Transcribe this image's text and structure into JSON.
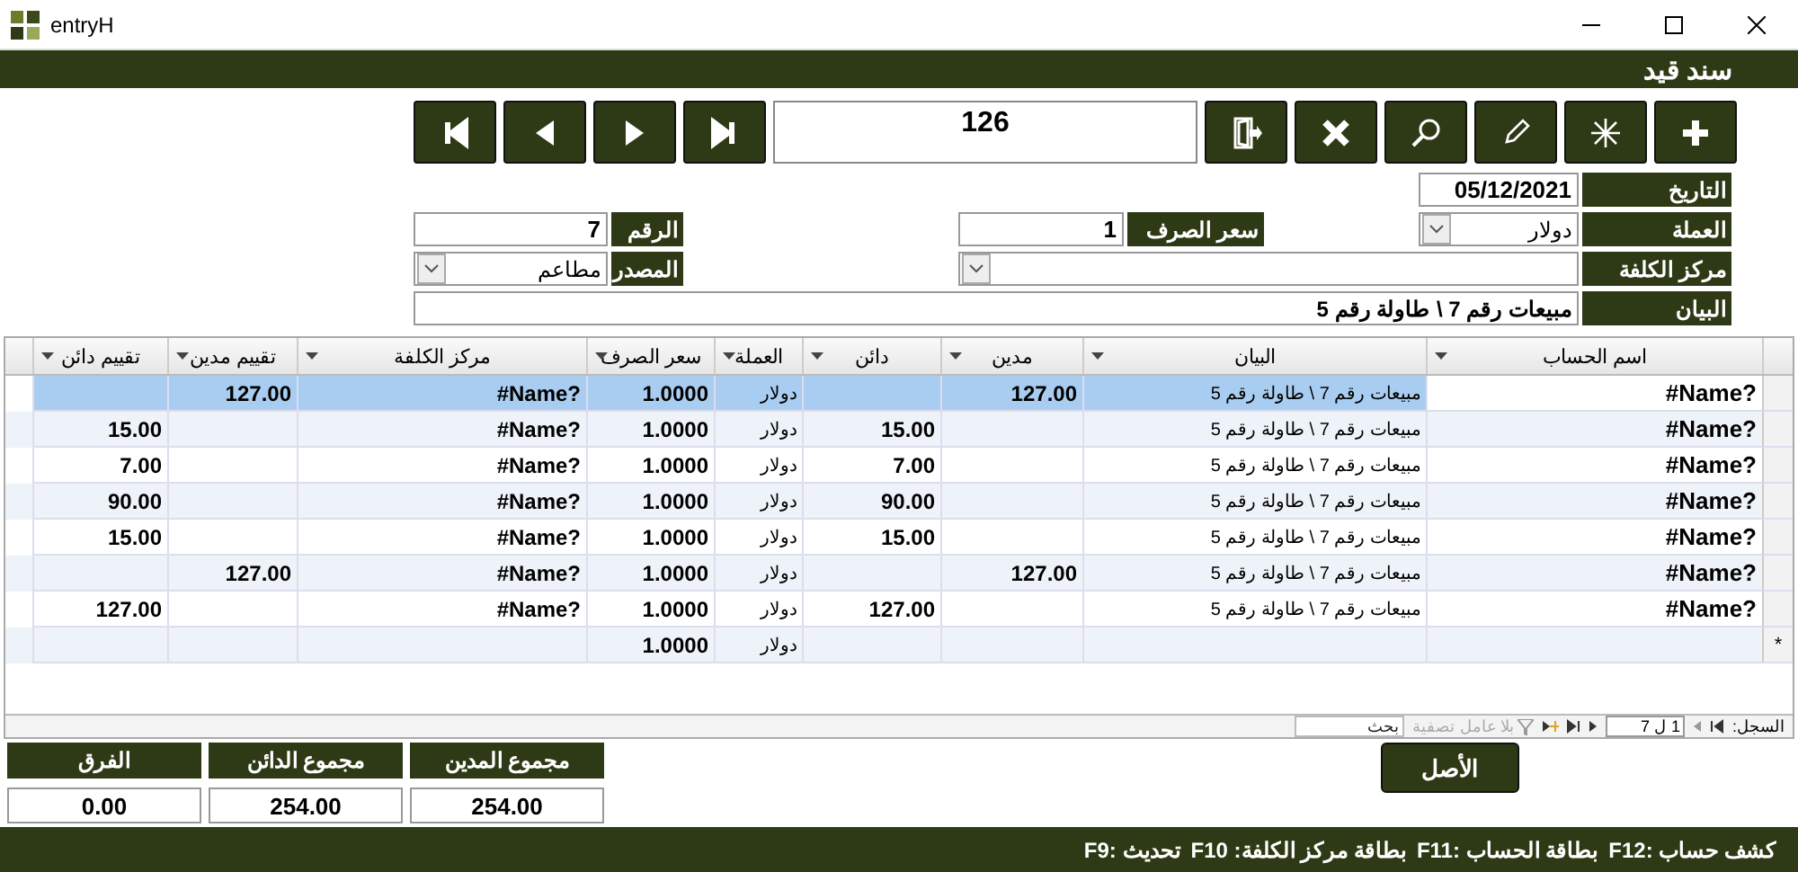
{
  "window": {
    "title": "entryH"
  },
  "header": {
    "title": "سند قيد"
  },
  "toolbar": {
    "record_number": "126"
  },
  "form": {
    "date_label": "التاريخ",
    "date": "05/12/2021",
    "currency_label": "العملة",
    "currency": "دولار",
    "rate_label": "سعر الصرف",
    "rate": "1",
    "number_label": "الرقم",
    "number": "7",
    "cost_center_label": "مركز الكلفة",
    "source_label": "المصدر",
    "source": "مطاعم",
    "description_label": "البيان",
    "description": "مبيعات رقم 7 \\ طاولة رقم 5"
  },
  "grid": {
    "columns": [
      {
        "label": "اسم الحساب"
      },
      {
        "label": "البيان"
      },
      {
        "label": "مدين"
      },
      {
        "label": "دائن"
      },
      {
        "label": "العملة"
      },
      {
        "label": "سعر الصرف"
      },
      {
        "label": "مركز الكلفة"
      },
      {
        "label": "تقييم مدين"
      },
      {
        "label": "تقييم دائن"
      }
    ],
    "rows": [
      {
        "selected": true,
        "account": "#Name?",
        "description": "مبيعات رقم 7 \\ طاولة رقم 5",
        "debit": "127.00",
        "currency": "دولار",
        "rate": "1.0000",
        "cost_center": "#Name?",
        "eval_debit": "127.00"
      },
      {
        "selected": false,
        "account": "#Name?",
        "description": "مبيعات رقم 7 \\ طاولة رقم 5",
        "credit": "15.00",
        "currency": "دولار",
        "rate": "1.0000",
        "cost_center": "#Name?",
        "eval_credit": "15.00"
      },
      {
        "selected": false,
        "account": "#Name?",
        "description": "مبيعات رقم 7 \\ طاولة رقم 5",
        "credit": "7.00",
        "currency": "دولار",
        "rate": "1.0000",
        "cost_center": "#Name?",
        "eval_credit": "7.00"
      },
      {
        "selected": false,
        "account": "#Name?",
        "description": "مبيعات رقم 7 \\ طاولة رقم 5",
        "credit": "90.00",
        "currency": "دولار",
        "rate": "1.0000",
        "cost_center": "#Name?",
        "eval_credit": "90.00"
      },
      {
        "selected": false,
        "account": "#Name?",
        "description": "مبيعات رقم 7 \\ طاولة رقم 5",
        "credit": "15.00",
        "currency": "دولار",
        "rate": "1.0000",
        "cost_center": "#Name?",
        "eval_credit": "15.00"
      },
      {
        "selected": false,
        "account": "#Name?",
        "description": "مبيعات رقم 7 \\ طاولة رقم 5",
        "debit": "127.00",
        "currency": "دولار",
        "rate": "1.0000",
        "cost_center": "#Name?",
        "eval_debit": "127.00"
      },
      {
        "selected": false,
        "account": "#Name?",
        "description": "مبيعات رقم 7 \\ طاولة رقم 5",
        "credit": "127.00",
        "currency": "دولار",
        "rate": "1.0000",
        "cost_center": "#Name?",
        "eval_credit": "127.00"
      }
    ],
    "new_row": {
      "marker": "*",
      "currency": "دولار",
      "rate": "1.0000"
    }
  },
  "navigation": {
    "label": "السجل:",
    "position": "1 ل 7",
    "filter": "بلا عامل تصفية",
    "search_placeholder": "بحث"
  },
  "totals": [
    {
      "label": "مجموع المدين",
      "value": "254.00"
    },
    {
      "label": "مجموع الدائن",
      "value": "254.00"
    },
    {
      "label": "الفرق",
      "value": "0.00"
    }
  ],
  "original_button": "الأصل",
  "status_bar": [
    "كشف حساب :F12",
    "بطاقة الحساب :F11",
    "بطاقة مركز الكلفة: F10",
    "تحديث :F9"
  ]
}
